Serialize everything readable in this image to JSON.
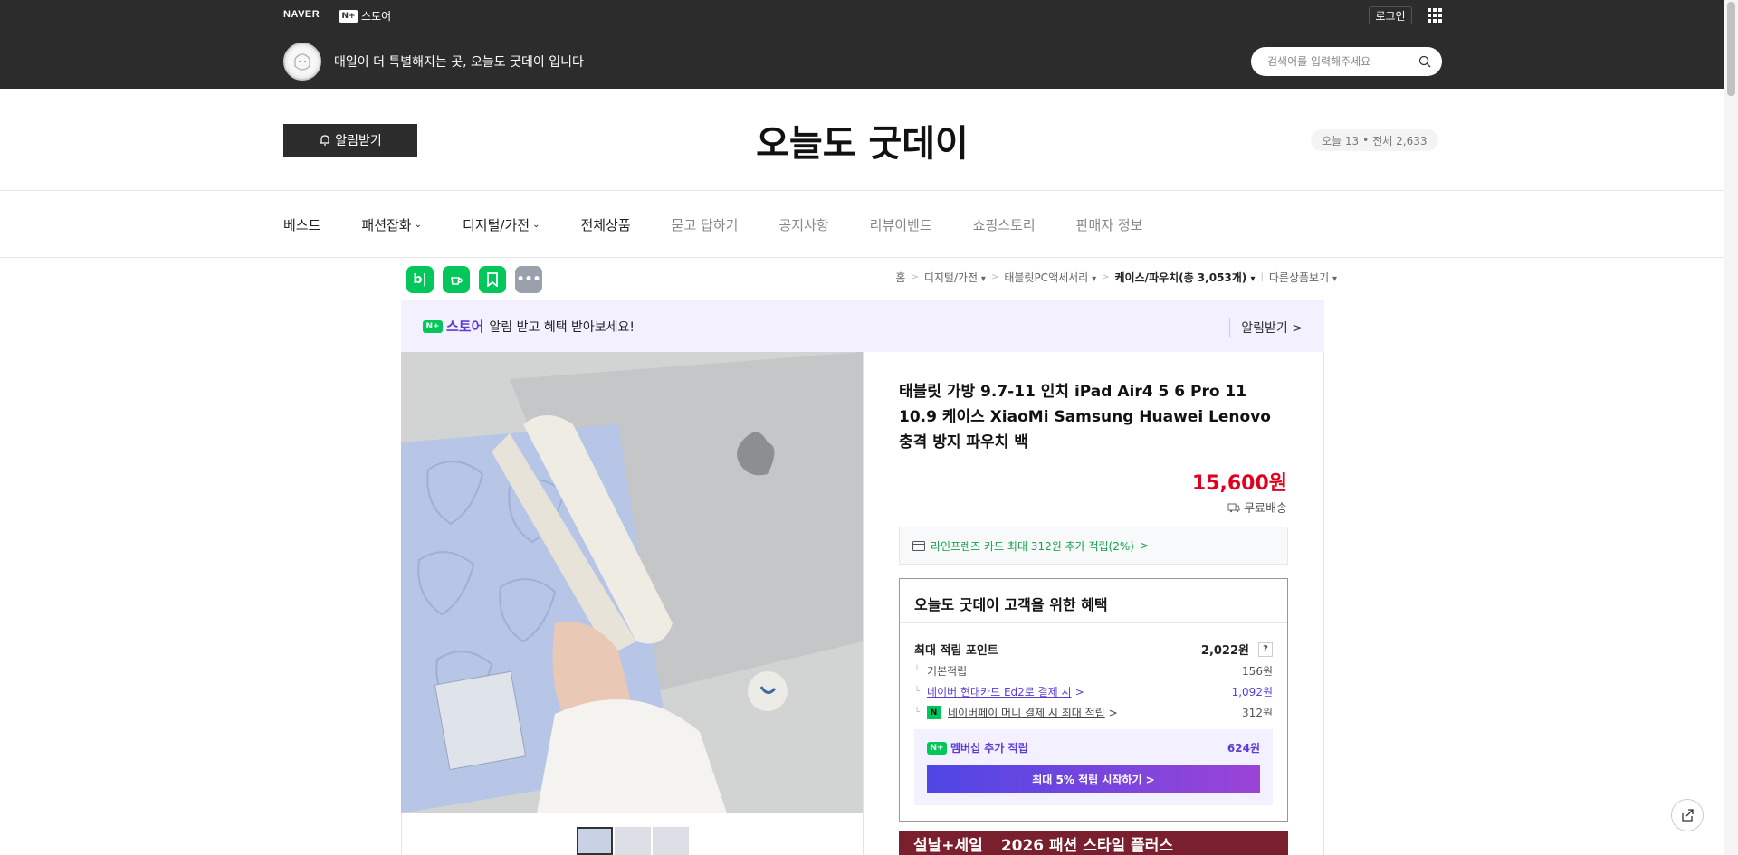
{
  "header": {
    "naver_logo": "NAVER",
    "nplus_badge": "N+",
    "nplus_label": "스토어",
    "login": "로그인",
    "tagline": "매일이 더 특별해지는 곳, 오늘도 굿데이 입니다",
    "search_placeholder": "검색어를 입력해주세요"
  },
  "store": {
    "notify_button": "알림받기",
    "title": "오늘도 굿데이",
    "visitors_today": "오늘 13",
    "visitors_sep": "•",
    "visitors_total": "전체 2,633"
  },
  "nav": {
    "items": [
      {
        "label": "베스트"
      },
      {
        "label": "패션잡화"
      },
      {
        "label": "디지털/가전"
      },
      {
        "label": "전체상품"
      },
      {
        "label": "묻고 답하기"
      },
      {
        "label": "공지사항"
      },
      {
        "label": "리뷰이벤트"
      },
      {
        "label": "쇼핑스토리"
      },
      {
        "label": "판매자 정보"
      }
    ]
  },
  "share_icons": [
    "blog-icon",
    "cafe-icon",
    "bookmark-icon",
    "more-icon"
  ],
  "breadcrumb": {
    "home": "홈",
    "cat1": "디지털/가전",
    "cat2": "태블릿PC액세서리",
    "cat3": "케이스/파우치(총 3,053개)",
    "other": "다른상품보기"
  },
  "promo": {
    "store_badge": "N+",
    "store_label": "스토어",
    "text": "알림 받고 혜택 받아보세요!",
    "action": "알림받기"
  },
  "product": {
    "title": "태블릿 가방 9.7-11 인치 iPad Air4 5 6 Pro 11 10.9 케이스 XiaoMi Samsung Huawei Lenovo 충격 방지 파우치 백",
    "price": "15,600원",
    "shipping": "무료배송",
    "card_benefit": "라인프렌즈 카드 최대 312원 추가 적립(2%)"
  },
  "benefits": {
    "title": "오늘도 굿데이 고객을 위한 혜택",
    "max_points_label": "최대 적립 포인트",
    "max_points_value": "2,022원",
    "help": "?",
    "basic_label": "기본적립",
    "basic_value": "156원",
    "hyundai_label": "네이버 현대카드 Ed2로 결제 시",
    "hyundai_value": "1,092원",
    "npay_badge": "N",
    "npay_label": "네이버페이 머니 결제 시 최대 적립",
    "npay_value": "312원",
    "member_badge": "N+",
    "member_label": "멤버십 추가 적립",
    "member_value": "624원",
    "member_cta": "최대 5% 적립 시작하기 >"
  },
  "sale_banner": {
    "left": "설날+세일",
    "right": "2026 패션 스타일 플러스"
  },
  "colors": {
    "topbar": "#2c2c2c",
    "price": "#e1001e",
    "accent_purple": "#5b3dd6",
    "naver_green": "#03c75a"
  }
}
